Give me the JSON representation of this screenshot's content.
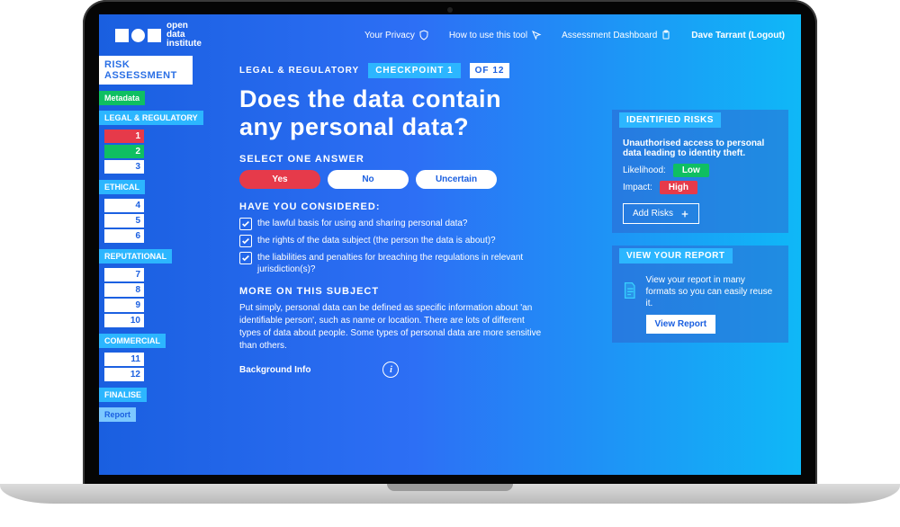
{
  "brand": {
    "l1": "open",
    "l2": "data",
    "l3": "institute"
  },
  "header": {
    "privacy": "Your Privacy",
    "howto": "How to use this tool",
    "dashboard": "Assessment Dashboard",
    "user": "Dave Tarrant",
    "logout": "(Logout)"
  },
  "sidebar": {
    "title_l1": "RISK",
    "title_l2": "ASSESSMENT",
    "metadata": "Metadata",
    "legal": "LEGAL & REGULATORY",
    "ethical": "ETHICAL",
    "reputational": "REPUTATIONAL",
    "commercial": "COMMERCIAL",
    "finalise": "FINALISE",
    "report": "Report",
    "n1": "1",
    "n2": "2",
    "n3": "3",
    "n4": "4",
    "n5": "5",
    "n6": "6",
    "n7": "7",
    "n8": "8",
    "n9": "9",
    "n10": "10",
    "n11": "11",
    "n12": "12"
  },
  "main": {
    "category": "LEGAL & REGULATORY",
    "checkpoint": "CHECKPOINT 1",
    "of": "OF 12",
    "question": "Does the data contain any personal data?",
    "select": "SELECT ONE ANSWER",
    "ans_yes": "Yes",
    "ans_no": "No",
    "ans_unc": "Uncertain",
    "considered": "HAVE YOU CONSIDERED:",
    "c1": "the lawful basis for using and sharing personal data?",
    "c2": "the rights of the data subject (the person the data is about)?",
    "c3": "the liabilities and penalties for breaching the regulations in relevant jurisdiction(s)?",
    "more": "MORE ON THIS SUBJECT",
    "blurb": "Put simply, personal data can be defined as specific information about 'an identifiable person', such as name or location. There are lots of different types of data about people. Some types of personal data are more sensitive than others.",
    "bginfo": "Background Info"
  },
  "risks": {
    "title": "IDENTIFIED RISKS",
    "desc": "Unauthorised access to personal data leading to identity theft.",
    "likelihood_lbl": "Likelihood:",
    "likelihood_val": "Low",
    "impact_lbl": "Impact:",
    "impact_val": "High",
    "add": "Add Risks"
  },
  "report": {
    "title": "VIEW YOUR REPORT",
    "desc": "View your report in many formats so you can easily reuse it.",
    "btn": "View Report"
  }
}
